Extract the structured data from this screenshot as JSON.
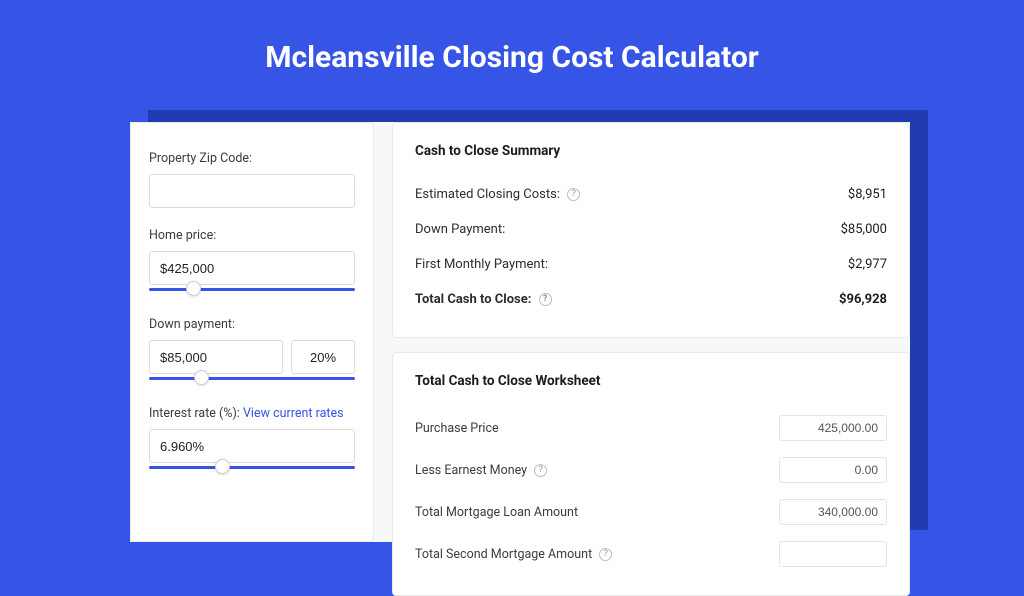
{
  "title": "Mcleansville Closing Cost Calculator",
  "left": {
    "zip_label": "Property Zip Code:",
    "zip_value": "",
    "home_price_label": "Home price:",
    "home_price_value": "$425,000",
    "home_price_slider_pct": 18,
    "down_payment_label": "Down payment:",
    "down_payment_value": "$85,000",
    "down_payment_pct": "20%",
    "down_payment_slider_pct": 22,
    "interest_label": "Interest rate (%):",
    "interest_link": "View current rates",
    "interest_value": "6.960%",
    "interest_slider_pct": 32
  },
  "summary": {
    "heading": "Cash to Close Summary",
    "rows": [
      {
        "label": "Estimated Closing Costs:",
        "help": true,
        "value": "$8,951"
      },
      {
        "label": "Down Payment:",
        "help": false,
        "value": "$85,000"
      },
      {
        "label": "First Monthly Payment:",
        "help": false,
        "value": "$2,977"
      }
    ],
    "total_label": "Total Cash to Close:",
    "total_value": "$96,928"
  },
  "worksheet": {
    "heading": "Total Cash to Close Worksheet",
    "rows": [
      {
        "label": "Purchase Price",
        "help": false,
        "value": "425,000.00"
      },
      {
        "label": "Less Earnest Money",
        "help": true,
        "value": "0.00"
      },
      {
        "label": "Total Mortgage Loan Amount",
        "help": false,
        "value": "340,000.00"
      },
      {
        "label": "Total Second Mortgage Amount",
        "help": true,
        "value": ""
      }
    ]
  }
}
